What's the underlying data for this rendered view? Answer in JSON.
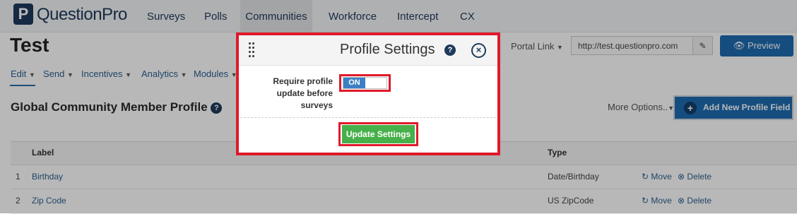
{
  "brand": {
    "logo_letter": "P",
    "logo_text": "QuestionPro"
  },
  "topnav": [
    "Surveys",
    "Polls",
    "Communities",
    "Workforce",
    "Intercept",
    "CX"
  ],
  "page_title": "Test",
  "submenu": [
    "Edit",
    "Send",
    "Incentives",
    "Analytics",
    "Modules"
  ],
  "header_right": {
    "portal_link": "Portal Link",
    "url": "http://test.questionpro.com",
    "preview": "Preview"
  },
  "section": {
    "title": "Global Community Member Profile",
    "more_options": "More Options..",
    "add_field": "Add New Profile Field"
  },
  "table": {
    "headers": {
      "label": "Label",
      "type": "Type"
    },
    "rows": [
      {
        "num": "1",
        "label": "Birthday",
        "type": "Date/Birthday",
        "move": "Move",
        "delete": "Delete"
      },
      {
        "num": "2",
        "label": "Zip Code",
        "type": "US ZipCode",
        "move": "Move",
        "delete": "Delete"
      }
    ]
  },
  "modal": {
    "title": "Profile Settings",
    "require_label": "Require profile update before surveys",
    "toggle_state": "ON",
    "update_button": "Update Settings"
  },
  "colors": {
    "brand": "#1e3a5c",
    "accent": "#1e6bb0",
    "highlight": "#e0192a",
    "success": "#46b04a"
  }
}
